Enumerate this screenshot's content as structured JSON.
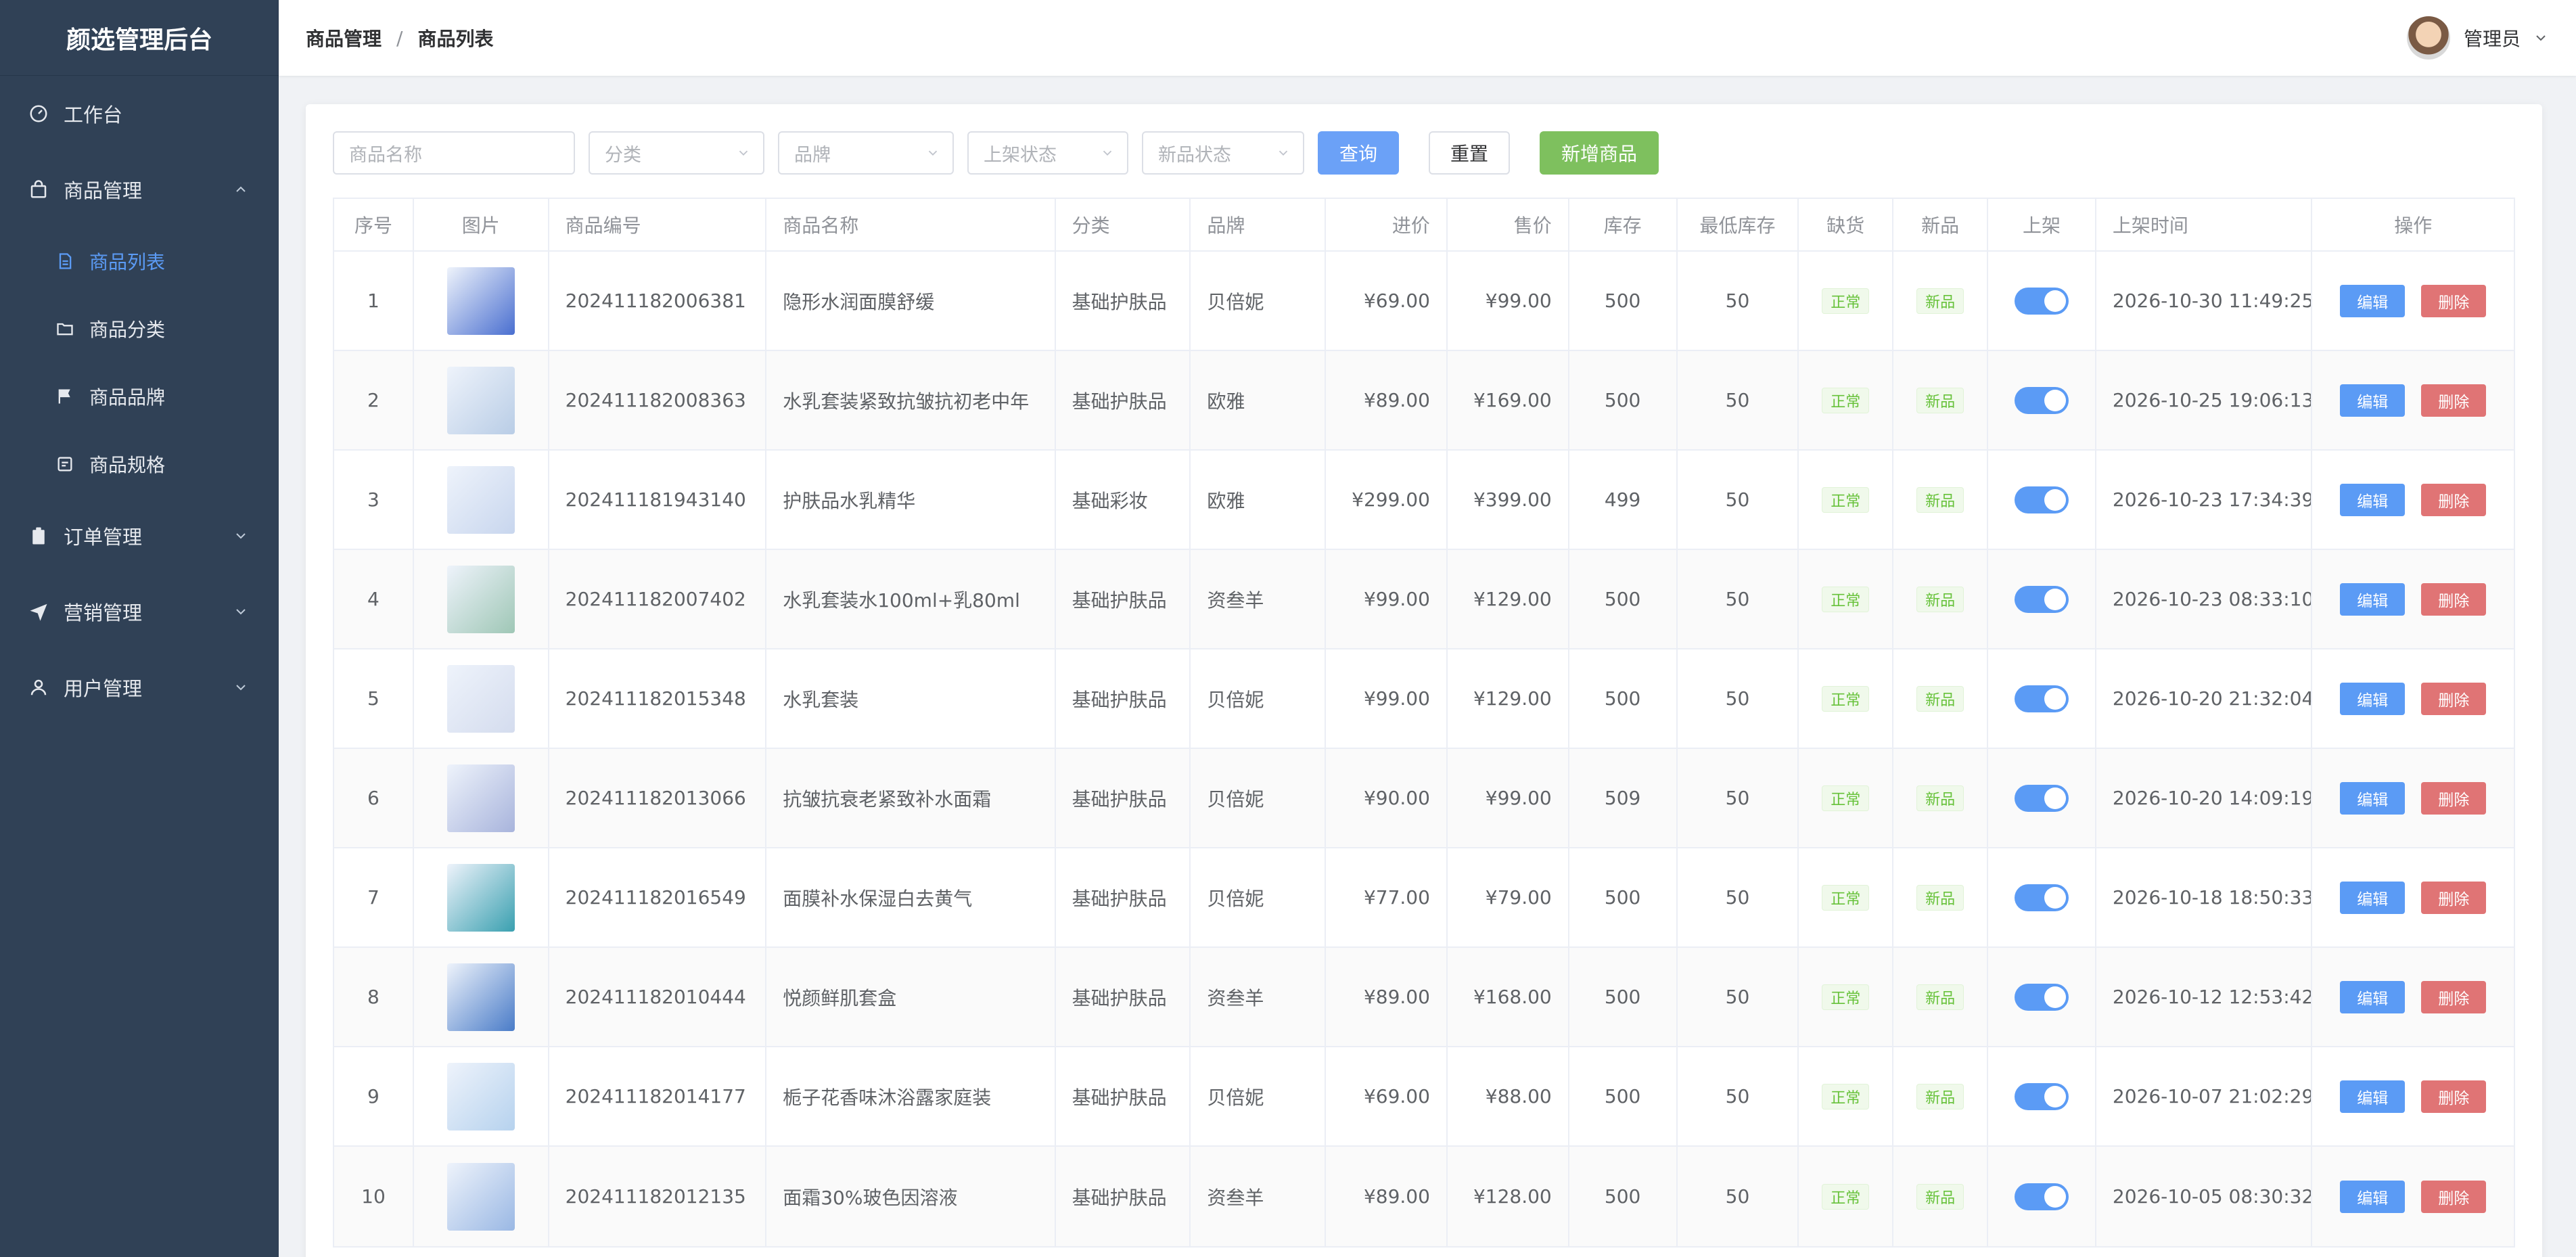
{
  "sidebar": {
    "brand": "颜选管理后台",
    "items": [
      {
        "label": "工作台"
      },
      {
        "label": "商品管理",
        "sub": [
          {
            "label": "商品列表"
          },
          {
            "label": "商品分类"
          },
          {
            "label": "商品品牌"
          },
          {
            "label": "商品规格"
          }
        ]
      },
      {
        "label": "订单管理"
      },
      {
        "label": "营销管理"
      },
      {
        "label": "用户管理"
      }
    ]
  },
  "header": {
    "breadcrumb": [
      "商品管理",
      "商品列表"
    ],
    "separator": "/",
    "user_name": "管理员"
  },
  "filters": {
    "name_placeholder": "商品名称",
    "category_placeholder": "分类",
    "brand_placeholder": "品牌",
    "shelf_placeholder": "上架状态",
    "new_placeholder": "新品状态",
    "query_label": "查询",
    "reset_label": "重置",
    "add_label": "新增商品"
  },
  "table": {
    "headers": [
      "序号",
      "图片",
      "商品编号",
      "商品名称",
      "分类",
      "品牌",
      "进价",
      "售价",
      "库存",
      "最低库存",
      "缺货",
      "新品",
      "上架",
      "上架时间",
      "操作"
    ],
    "edit_label": "编辑",
    "delete_label": "删除",
    "rows": [
      {
        "seq": "1",
        "code": "202411182006381",
        "name": "隐形水润面膜舒缓",
        "category": "基础护肤品",
        "brand": "贝倍妮",
        "cost": "¥69.00",
        "price": "¥99.00",
        "stock": "500",
        "min_stock": "50",
        "shortage": "正常",
        "new": "新品",
        "on_shelf": true,
        "time": "2026-10-30 11:49:25",
        "thumb": "#4a6fd0"
      },
      {
        "seq": "2",
        "code": "202411182008363",
        "name": "水乳套装紧致抗皱抗初老中年",
        "category": "基础护肤品",
        "brand": "欧雅",
        "cost": "¥89.00",
        "price": "¥169.00",
        "stock": "500",
        "min_stock": "50",
        "shortage": "正常",
        "new": "新品",
        "on_shelf": true,
        "time": "2026-10-25 19:06:13",
        "thumb": "#b9cde6"
      },
      {
        "seq": "3",
        "code": "202411181943140",
        "name": "护肤品水乳精华",
        "category": "基础彩妆",
        "brand": "欧雅",
        "cost": "¥299.00",
        "price": "¥399.00",
        "stock": "499",
        "min_stock": "50",
        "shortage": "正常",
        "new": "新品",
        "on_shelf": true,
        "time": "2026-10-23 17:34:39",
        "thumb": "#c8d6ee"
      },
      {
        "seq": "4",
        "code": "202411182007402",
        "name": "水乳套装水100ml+乳80ml",
        "category": "基础护肤品",
        "brand": "资叁羊",
        "cost": "¥99.00",
        "price": "¥129.00",
        "stock": "500",
        "min_stock": "50",
        "shortage": "正常",
        "new": "新品",
        "on_shelf": true,
        "time": "2026-10-23 08:33:10",
        "thumb": "#9fc7b6"
      },
      {
        "seq": "5",
        "code": "202411182015348",
        "name": "水乳套装",
        "category": "基础护肤品",
        "brand": "贝倍妮",
        "cost": "¥99.00",
        "price": "¥129.00",
        "stock": "500",
        "min_stock": "50",
        "shortage": "正常",
        "new": "新品",
        "on_shelf": true,
        "time": "2026-10-20 21:32:04",
        "thumb": "#d4dcee"
      },
      {
        "seq": "6",
        "code": "202411182013066",
        "name": "抗皱抗衰老紧致补水面霜",
        "category": "基础护肤品",
        "brand": "贝倍妮",
        "cost": "¥90.00",
        "price": "¥99.00",
        "stock": "509",
        "min_stock": "50",
        "shortage": "正常",
        "new": "新品",
        "on_shelf": true,
        "time": "2026-10-20 14:09:19",
        "thumb": "#a8b4dc"
      },
      {
        "seq": "7",
        "code": "202411182016549",
        "name": "面膜补水保湿白去黄气",
        "category": "基础护肤品",
        "brand": "贝倍妮",
        "cost": "¥77.00",
        "price": "¥79.00",
        "stock": "500",
        "min_stock": "50",
        "shortage": "正常",
        "new": "新品",
        "on_shelf": true,
        "time": "2026-10-18 18:50:33",
        "thumb": "#3aa0b0"
      },
      {
        "seq": "8",
        "code": "202411182010444",
        "name": "悦颜鲜肌套盒",
        "category": "基础护肤品",
        "brand": "资叁羊",
        "cost": "¥89.00",
        "price": "¥168.00",
        "stock": "500",
        "min_stock": "50",
        "shortage": "正常",
        "new": "新品",
        "on_shelf": true,
        "time": "2026-10-12 12:53:42",
        "thumb": "#4a7cc8"
      },
      {
        "seq": "9",
        "code": "202411182014177",
        "name": "栀子花香味沐浴露家庭装",
        "category": "基础护肤品",
        "brand": "贝倍妮",
        "cost": "¥69.00",
        "price": "¥88.00",
        "stock": "500",
        "min_stock": "50",
        "shortage": "正常",
        "new": "新品",
        "on_shelf": true,
        "time": "2026-10-07 21:02:29",
        "thumb": "#b6d2ee"
      },
      {
        "seq": "10",
        "code": "202411182012135",
        "name": "面霜30%玻色因溶液",
        "category": "基础护肤品",
        "brand": "资叁羊",
        "cost": "¥89.00",
        "price": "¥128.00",
        "stock": "500",
        "min_stock": "50",
        "shortage": "正常",
        "new": "新品",
        "on_shelf": true,
        "time": "2026-10-05 08:30:32",
        "thumb": "#9ab8e4"
      }
    ]
  }
}
